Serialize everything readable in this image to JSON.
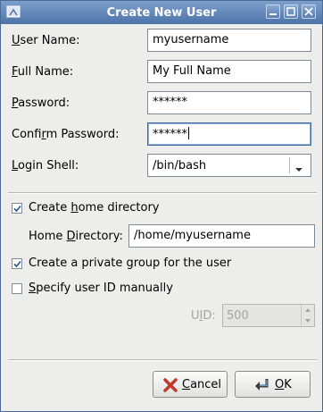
{
  "window": {
    "title": "Create New User"
  },
  "form": {
    "user_name": {
      "label_pre": "",
      "label_key": "U",
      "label_post": "ser Name:",
      "value": "myusername"
    },
    "full_name": {
      "label_pre": "",
      "label_key": "F",
      "label_post": "ull Name:",
      "value": "My Full Name"
    },
    "password": {
      "label_pre": "",
      "label_key": "P",
      "label_post": "assword:",
      "value": "******"
    },
    "confirm_password": {
      "label_pre": "Confi",
      "label_key": "r",
      "label_post": "m Password:",
      "value": "******"
    },
    "login_shell": {
      "label_pre": "",
      "label_key": "L",
      "label_post": "ogin Shell:",
      "value": "/bin/bash"
    }
  },
  "options": {
    "create_home": {
      "label_pre": "Create ",
      "label_key": "h",
      "label_post": "ome directory",
      "checked": true
    },
    "home_directory": {
      "label_pre": "Home ",
      "label_key": "D",
      "label_post": "irectory:",
      "value": "/home/myusername"
    },
    "private_group": {
      "label": "Create a private group for the user",
      "checked": true
    },
    "specify_uid": {
      "label_pre": "",
      "label_key": "S",
      "label_post": "pecify user ID manually",
      "checked": false
    },
    "uid": {
      "label_pre": "U",
      "label_key": "I",
      "label_post": "D:",
      "value": "500"
    }
  },
  "buttons": {
    "cancel": {
      "label_key": "C",
      "label_post": "ancel"
    },
    "ok": {
      "label_key": "O",
      "label_post": "K"
    }
  },
  "colors": {
    "titlebar": "#5b80b4",
    "focus": "#3d6aa5",
    "cancel_icon": "#c0392b"
  }
}
